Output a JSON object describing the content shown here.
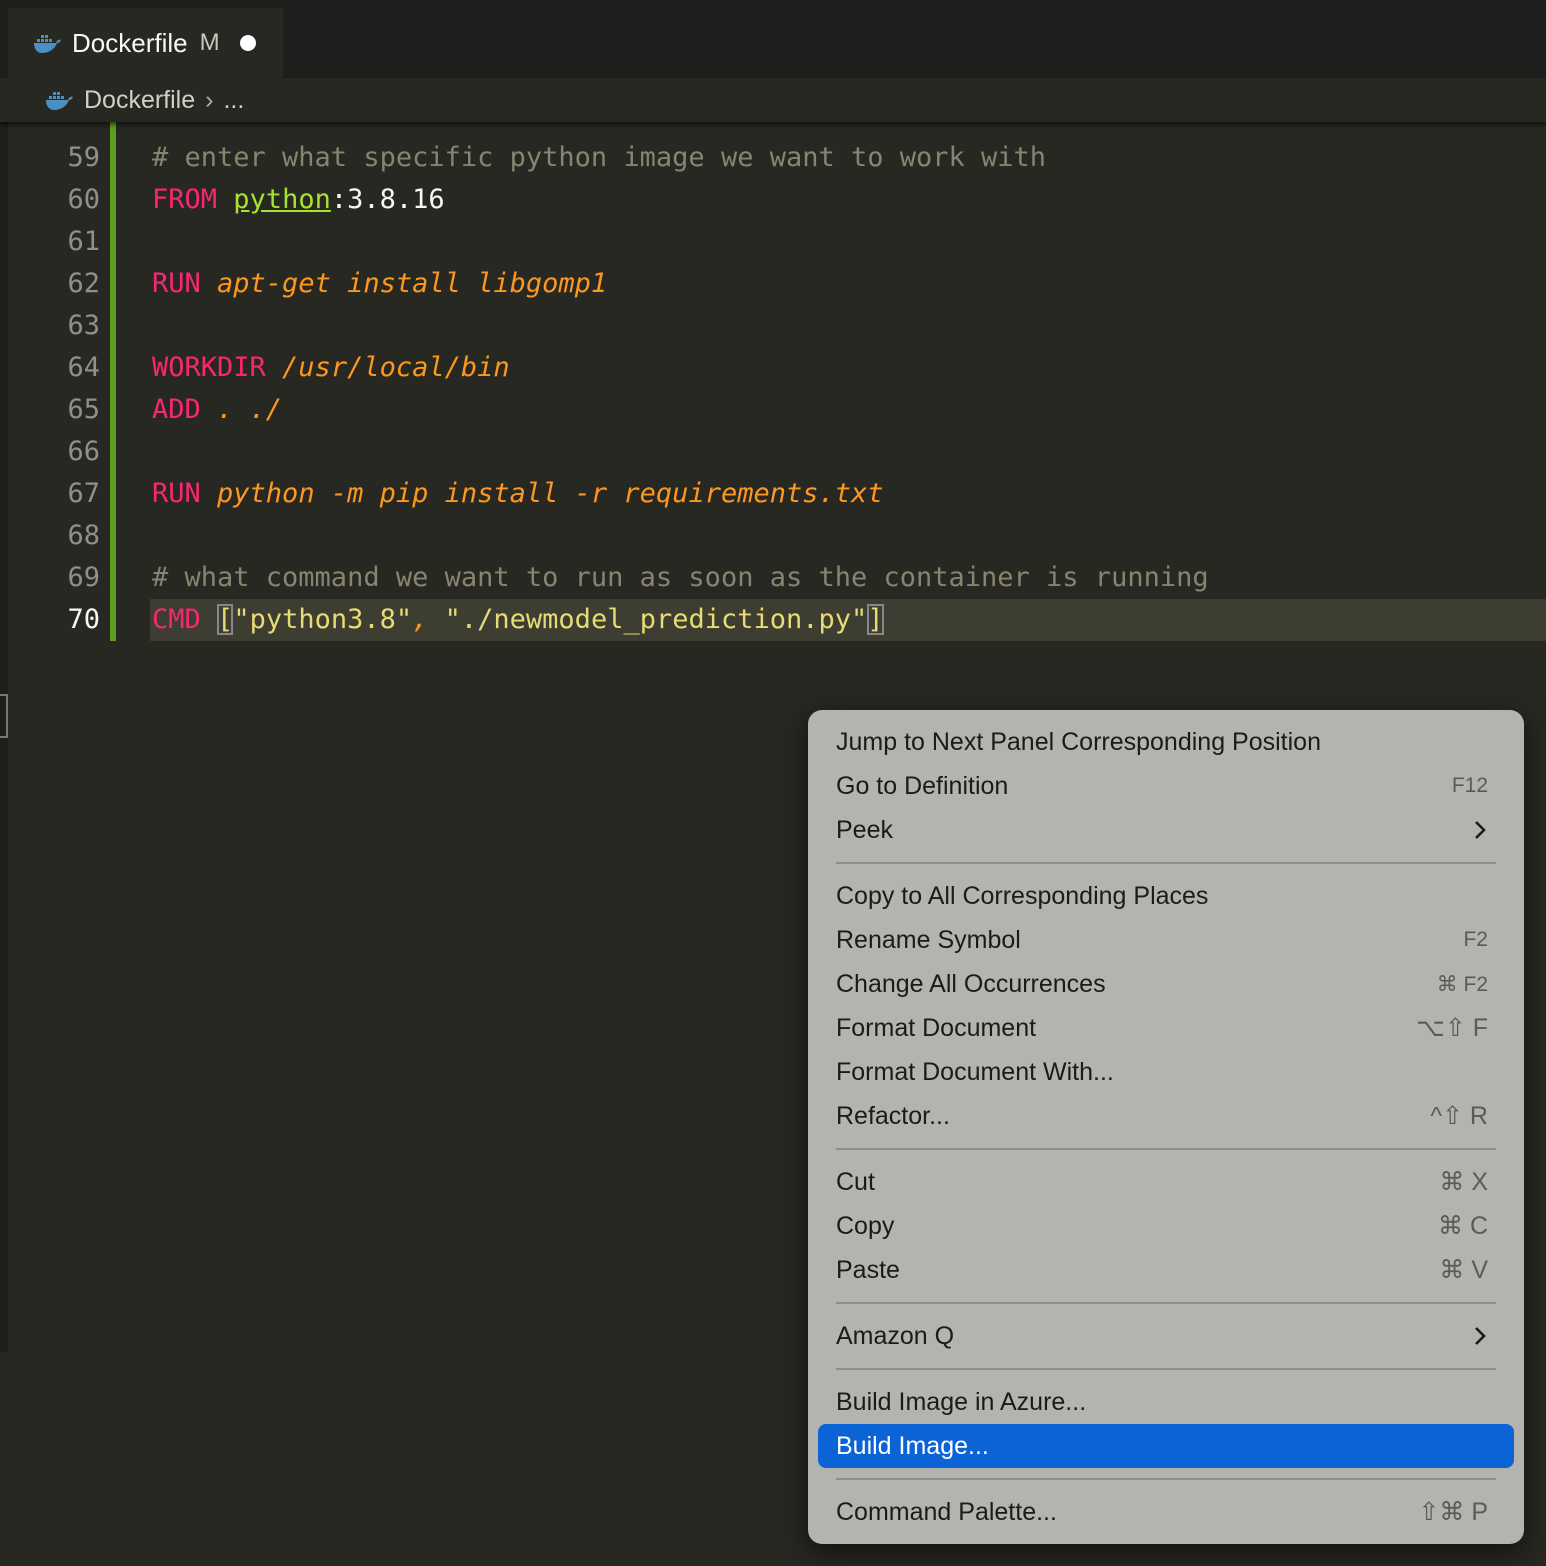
{
  "tab": {
    "title": "Dockerfile",
    "status": "M"
  },
  "breadcrumb": {
    "file": "Dockerfile",
    "more": "..."
  },
  "editor": {
    "lines": [
      {
        "num": "59",
        "tokens": [
          {
            "t": "# enter what specific python image we want to work with",
            "c": "tok-comment"
          }
        ]
      },
      {
        "num": "60",
        "tokens": [
          {
            "t": "FROM",
            "c": "tok-kw"
          },
          {
            "t": " ",
            "c": "tok-plain"
          },
          {
            "t": "python",
            "c": "tok-img"
          },
          {
            "t": ":3.8.16",
            "c": "tok-plain"
          }
        ]
      },
      {
        "num": "61",
        "tokens": []
      },
      {
        "num": "62",
        "tokens": [
          {
            "t": "RUN",
            "c": "tok-kw"
          },
          {
            "t": " apt-get install libgomp1",
            "c": "tok-arg"
          }
        ]
      },
      {
        "num": "63",
        "tokens": []
      },
      {
        "num": "64",
        "tokens": [
          {
            "t": "WORKDIR",
            "c": "tok-kw"
          },
          {
            "t": " /usr/local/bin",
            "c": "tok-arg"
          }
        ]
      },
      {
        "num": "65",
        "tokens": [
          {
            "t": "ADD",
            "c": "tok-kw"
          },
          {
            "t": " . ./",
            "c": "tok-arg"
          }
        ]
      },
      {
        "num": "66",
        "tokens": []
      },
      {
        "num": "67",
        "tokens": [
          {
            "t": "RUN",
            "c": "tok-kw"
          },
          {
            "t": " python -m pip install -r requirements.txt",
            "c": "tok-arg"
          }
        ]
      },
      {
        "num": "68",
        "tokens": []
      },
      {
        "num": "69",
        "tokens": [
          {
            "t": "# what command we want to run as soon as the container is running",
            "c": "tok-comment"
          }
        ]
      },
      {
        "num": "70",
        "current": true,
        "tokens": [
          {
            "t": "CMD",
            "c": "tok-kw"
          },
          {
            "t": " ",
            "c": "tok-plain"
          },
          {
            "t": "[",
            "c": "tok-br tok-br-y"
          },
          {
            "t": "\"python3.8\"",
            "c": "tok-str"
          },
          {
            "t": ", ",
            "c": "tok-arg"
          },
          {
            "t": "\"./newmodel_prediction.py\"",
            "c": "tok-str"
          },
          {
            "t": "]",
            "c": "tok-br tok-br-y"
          }
        ]
      }
    ]
  },
  "menu": {
    "groups": [
      [
        {
          "label": "Jump to Next Panel Corresponding Position",
          "key": ""
        },
        {
          "label": "Go to Definition",
          "key": "F12"
        },
        {
          "label": "Peek",
          "submenu": true
        }
      ],
      [
        {
          "label": "Copy to All Corresponding Places",
          "key": ""
        },
        {
          "label": "Rename Symbol",
          "key": "F2"
        },
        {
          "label": "Change All Occurrences",
          "key": "⌘ F2"
        },
        {
          "label": "Format Document",
          "key": "⌥⇧ F",
          "big": true
        },
        {
          "label": "Format Document With...",
          "key": ""
        },
        {
          "label": "Refactor...",
          "key": "^⇧ R",
          "big": true
        }
      ],
      [
        {
          "label": "Cut",
          "key": "⌘ X",
          "big": true
        },
        {
          "label": "Copy",
          "key": "⌘ C",
          "big": true
        },
        {
          "label": "Paste",
          "key": "⌘ V",
          "big": true
        }
      ],
      [
        {
          "label": "Amazon Q",
          "submenu": true
        }
      ],
      [
        {
          "label": "Build Image in Azure...",
          "key": ""
        },
        {
          "label": "Build Image...",
          "key": "",
          "active": true
        }
      ],
      [
        {
          "label": "Command Palette...",
          "key": "⇧⌘ P",
          "big": true
        }
      ]
    ]
  },
  "colors": {
    "accent": "#0b63d6",
    "gutter_modified": "#5c9e1e",
    "keyword": "#f92672",
    "argument": "#fd971f",
    "string": "#e6db74",
    "comment": "#88846f"
  }
}
